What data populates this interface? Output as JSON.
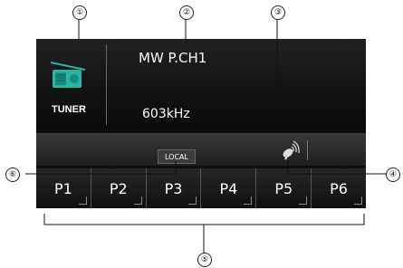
{
  "screen": {
    "source_icon": "radio-tuner-icon",
    "source_label": "TUNER",
    "band_label": "MW P.CH1",
    "frequency": "603kHz",
    "local_badge": "LOCAL",
    "signal_icon": "satellite-dish-icon"
  },
  "presets": [
    "P1",
    "P2",
    "P3",
    "P4",
    "P5",
    "P6"
  ],
  "callouts": [
    "①",
    "②",
    "③",
    "④",
    "⑤",
    "⑥"
  ],
  "colors": {
    "screen_bg": "#0d0d0d",
    "text": "#ffffff",
    "icon_teal": "#2bb3a4",
    "callout_line": "#111111"
  }
}
